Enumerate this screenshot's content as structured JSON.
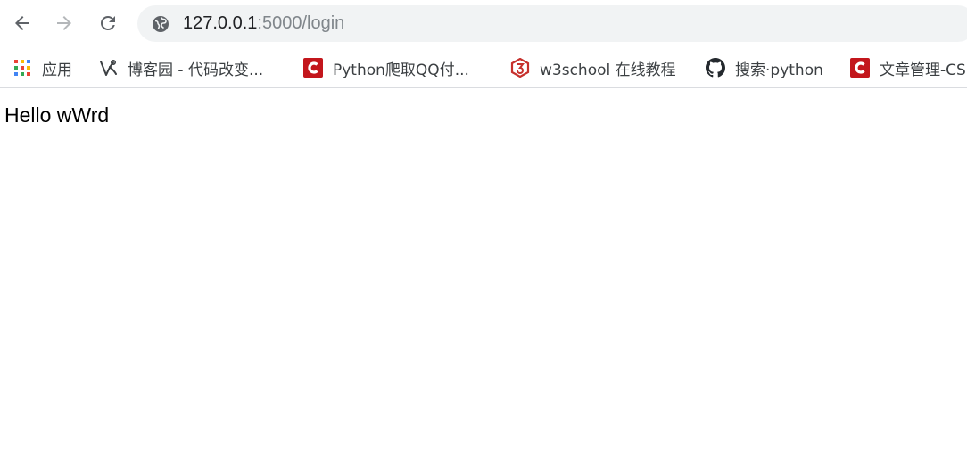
{
  "browser": {
    "url_host": "127.0.0.1",
    "url_path": ":5000/login"
  },
  "bookmarks": [
    {
      "label": "应用",
      "icon": "apps-grid-icon"
    },
    {
      "label": "博客园 - 代码改变...",
      "icon": "cnblogs-icon"
    },
    {
      "label": "Python爬取QQ付...",
      "icon": "csdn-icon"
    },
    {
      "label": "w3school 在线教程",
      "icon": "w3school-icon"
    },
    {
      "label": "搜索·python",
      "icon": "github-icon"
    },
    {
      "label": "文章管理-CS",
      "icon": "csdn-icon"
    }
  ],
  "page": {
    "text": "Hello wWrd"
  },
  "colors": {
    "csdn_red": "#c3161c",
    "w3school_red": "#c7312d",
    "omnibox_bg": "#f1f3f4"
  }
}
